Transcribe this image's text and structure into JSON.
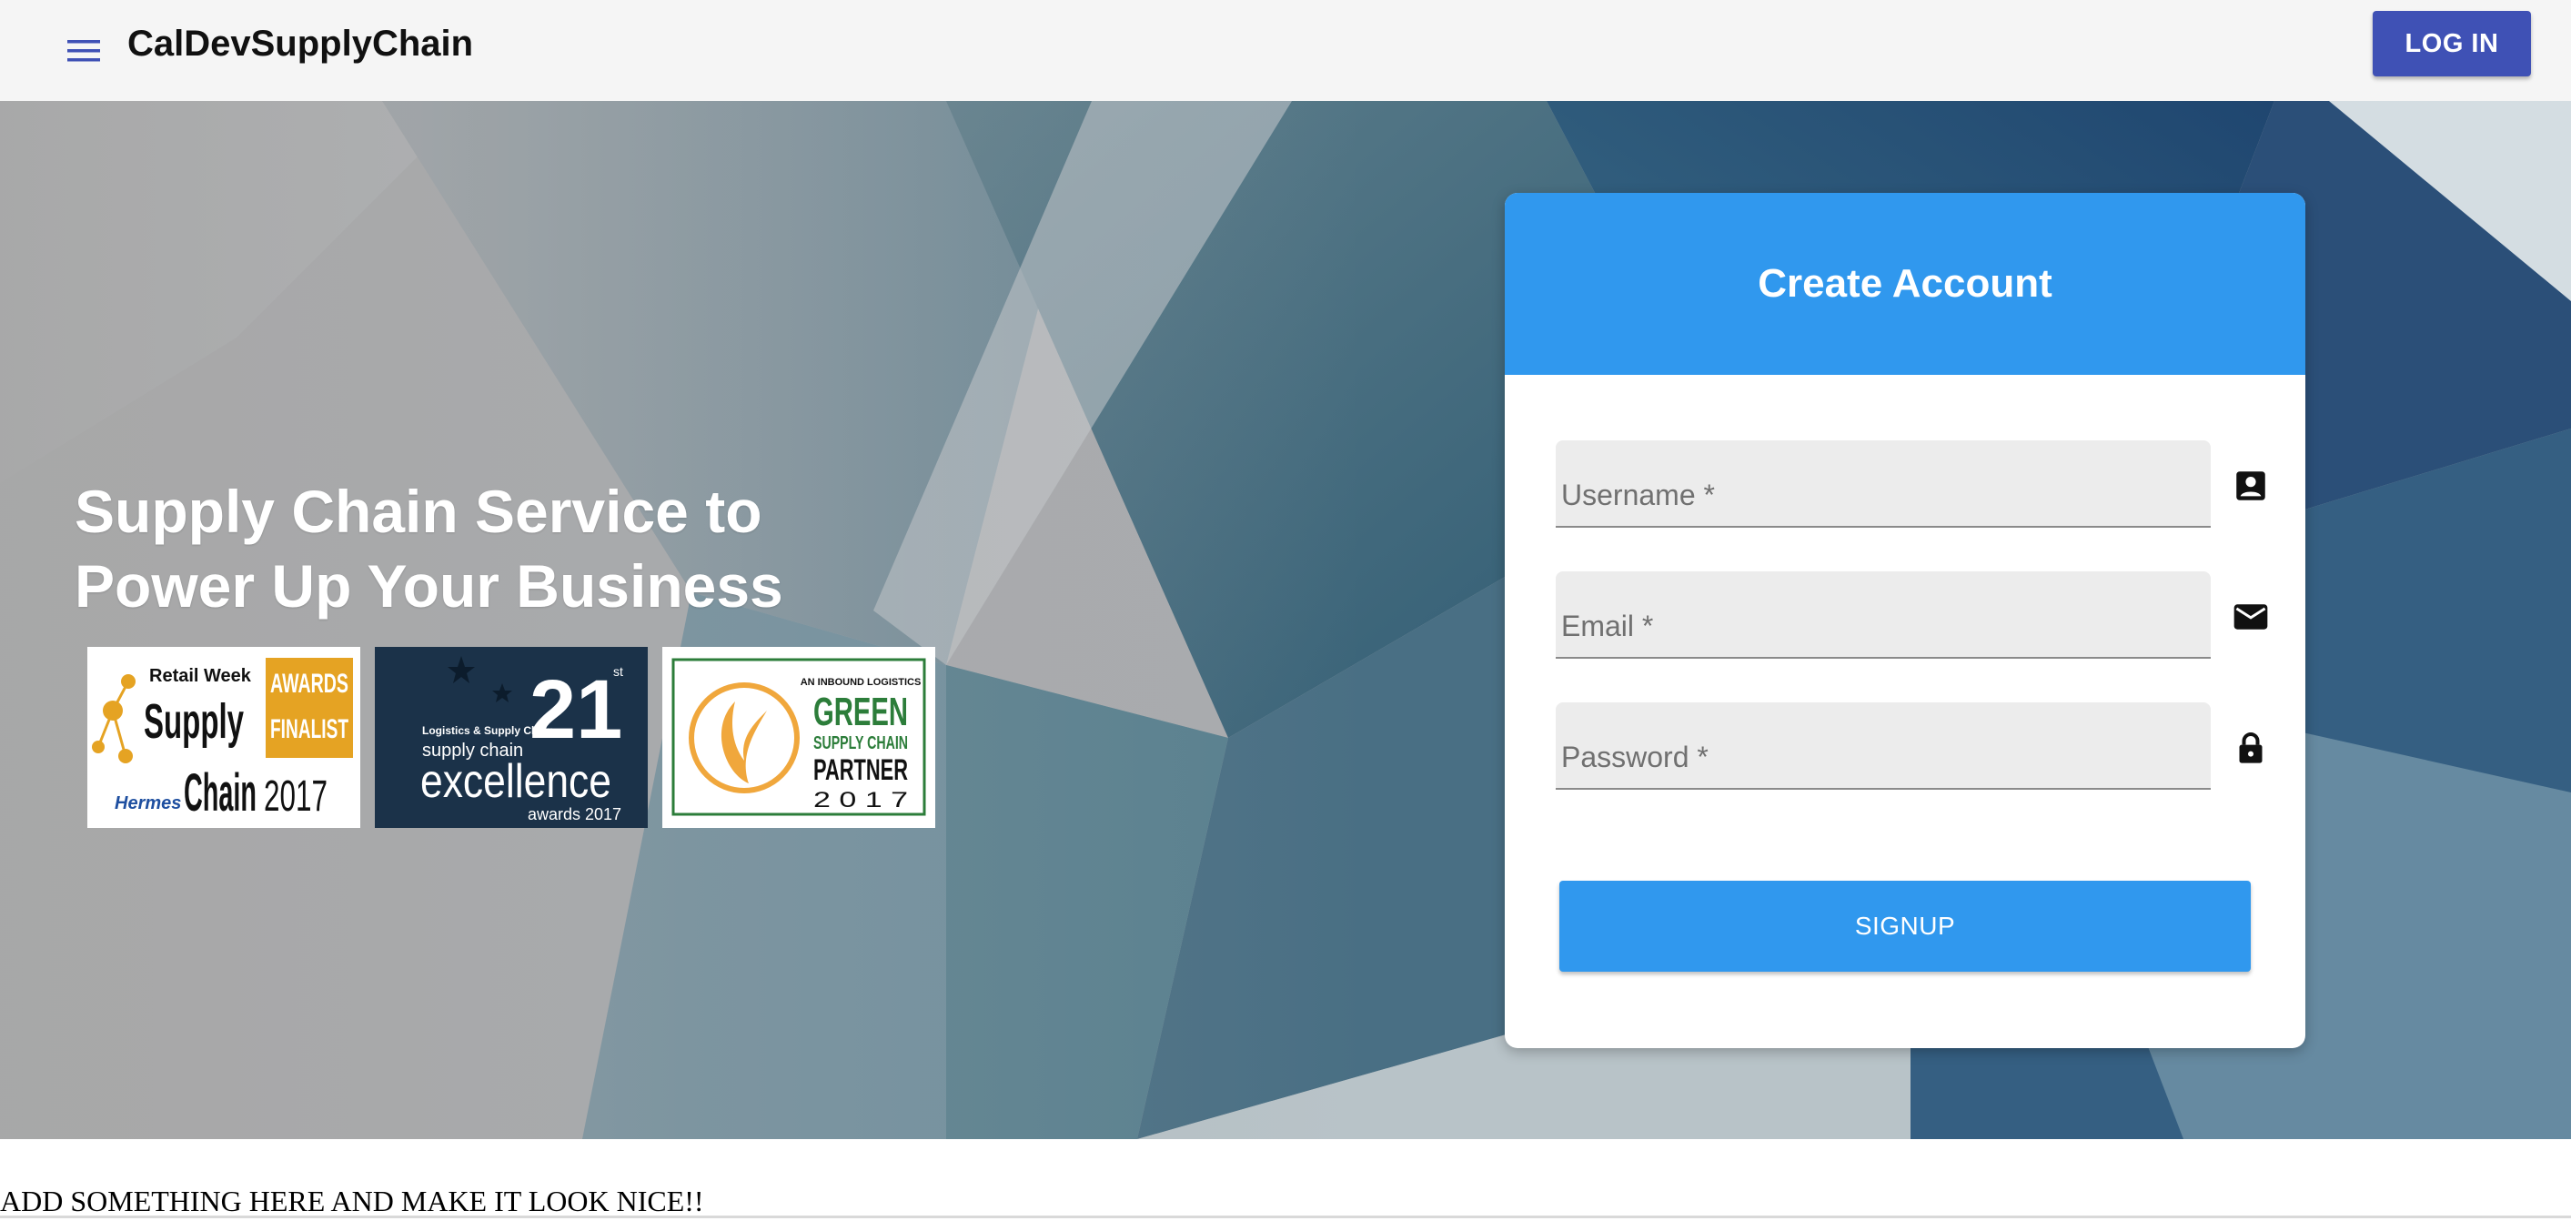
{
  "appbar": {
    "menu_icon": "hamburger-menu-icon",
    "title": "CalDevSupplyChain",
    "login_label": "LOG IN",
    "login_color": "#3f51b5"
  },
  "hero": {
    "headline_line1": "Supply Chain Service to",
    "headline_line2": "Power Up Your Business",
    "awards": [
      {
        "name": "retail-week-award",
        "line_a": "Retail Week",
        "line_b": "Supply",
        "line_c": "Chain",
        "line_d": "Hermes",
        "badge_1": "AWARDS",
        "badge_2": "FINALIST",
        "year": "2017"
      },
      {
        "name": "supply-chain-excellence-award",
        "number": "21",
        "superscript": "st",
        "line_a": "Logistics & Supply Chain",
        "line_b": "supply chain",
        "line_c": "excellence",
        "line_d": "awards 2017"
      },
      {
        "name": "green-supply-chain-award",
        "line_a": "AN INBOUND LOGISTICS",
        "line_b": "GREEN",
        "line_c": "SUPPLY CHAIN",
        "line_d": "PARTNER",
        "year": "2 0 1 7"
      }
    ]
  },
  "signup_card": {
    "title": "Create Account",
    "header_color": "#3098ee",
    "fields": [
      {
        "label": "Username *",
        "value": "",
        "icon": "account-box-icon"
      },
      {
        "label": "Email *",
        "value": "",
        "icon": "mail-icon"
      },
      {
        "label": "Password *",
        "value": "",
        "icon": "lock-icon"
      }
    ],
    "submit_label": "SIGNUP"
  },
  "footer": {
    "note": "ADD SOMETHING HERE AND MAKE IT LOOK NICE!!"
  }
}
